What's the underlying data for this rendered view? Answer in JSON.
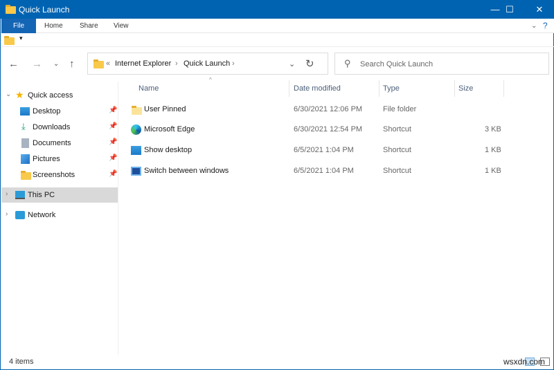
{
  "window": {
    "title": "Quick Launch",
    "min": "—",
    "max": "☐",
    "close": "✕"
  },
  "ribbon": {
    "tabs": [
      "File",
      "Home",
      "Share",
      "View"
    ]
  },
  "address": {
    "prefix": "«",
    "crumbs": [
      "Internet Explorer",
      "Quick Launch"
    ],
    "sep": "›"
  },
  "search": {
    "placeholder": "Search Quick Launch"
  },
  "sidebar": {
    "quick_access": "Quick access",
    "items": [
      "Desktop",
      "Downloads",
      "Documents",
      "Pictures",
      "Screenshots"
    ],
    "this_pc": "This PC",
    "network": "Network"
  },
  "columns": [
    "Name",
    "Date modified",
    "Type",
    "Size"
  ],
  "files": [
    {
      "name": "User Pinned",
      "date": "6/30/2021 12:06 PM",
      "type": "File folder",
      "size": ""
    },
    {
      "name": "Microsoft Edge",
      "date": "6/30/2021 12:54 PM",
      "type": "Shortcut",
      "size": "3 KB"
    },
    {
      "name": "Show desktop",
      "date": "6/5/2021 1:04 PM",
      "type": "Shortcut",
      "size": "1 KB"
    },
    {
      "name": "Switch between windows",
      "date": "6/5/2021 1:04 PM",
      "type": "Shortcut",
      "size": "1 KB"
    }
  ],
  "status": "4 items",
  "watermark": "wsxdn.com"
}
